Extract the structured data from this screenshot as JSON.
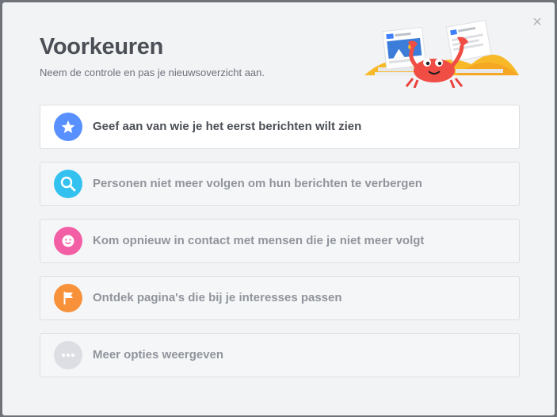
{
  "dialog": {
    "title": "Voorkeuren",
    "subtitle": "Neem de controle en pas je nieuwsoverzicht aan.",
    "close_icon": "×",
    "illustration": "crab-with-news-cards-illustration"
  },
  "options": [
    {
      "label": "Geef aan van wie je het eerst berichten wilt zien",
      "icon": "star-icon",
      "color": "#5890ff",
      "active": true
    },
    {
      "label": "Personen niet meer volgen om hun berichten te verbergen",
      "icon": "search-icon",
      "color": "#2abba7",
      "active": false
    },
    {
      "label": "Kom opnieuw in contact met mensen die je niet meer volgt",
      "icon": "smiley-icon",
      "color": "#f35369",
      "active": false
    },
    {
      "label": "Ontdek pagina's die bij je interesses passen",
      "icon": "flag-icon",
      "color": "#f7923b",
      "active": false
    },
    {
      "label": "Meer opties weergeven",
      "icon": "more-icon",
      "color": "#dcdee3",
      "active": false
    }
  ]
}
